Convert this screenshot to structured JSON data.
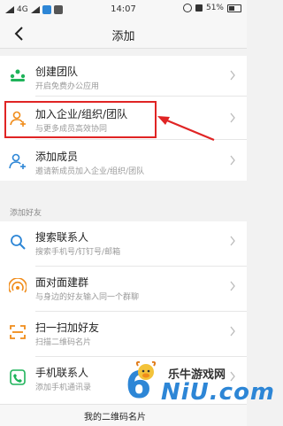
{
  "status_bar": {
    "network": "4G",
    "time": "14:07",
    "battery": "51%"
  },
  "header": {
    "title": "添加"
  },
  "top_group": {
    "items": [
      {
        "title": "创建团队",
        "subtitle": "开启免费办公应用",
        "icon": "team-create-icon"
      },
      {
        "title": "加入企业/组织/团队",
        "subtitle": "与更多成员高效协同",
        "icon": "join-org-icon"
      },
      {
        "title": "添加成员",
        "subtitle": "邀请新成员加入企业/组织/团队",
        "icon": "add-member-icon"
      }
    ]
  },
  "friends_section": {
    "label": "添加好友",
    "items": [
      {
        "title": "搜索联系人",
        "subtitle": "搜索手机号/钉钉号/邮箱",
        "icon": "search-icon"
      },
      {
        "title": "面对面建群",
        "subtitle": "与身边的好友输入同一个群聊",
        "icon": "face-to-face-icon"
      },
      {
        "title": "扫一扫加好友",
        "subtitle": "扫描二维码名片",
        "icon": "scan-icon"
      },
      {
        "title": "手机联系人",
        "subtitle": "添加手机通讯录",
        "icon": "phone-contacts-icon"
      }
    ]
  },
  "bottom": {
    "label": "我的二维码名片"
  },
  "watermark": {
    "number": "6",
    "name": "乐牛游戏网",
    "url": "NiU.com"
  },
  "colors": {
    "highlight": "#e02424",
    "accent_orange": "#f08c1a",
    "accent_blue": "#2d86d6",
    "accent_green": "#1fb35a"
  }
}
